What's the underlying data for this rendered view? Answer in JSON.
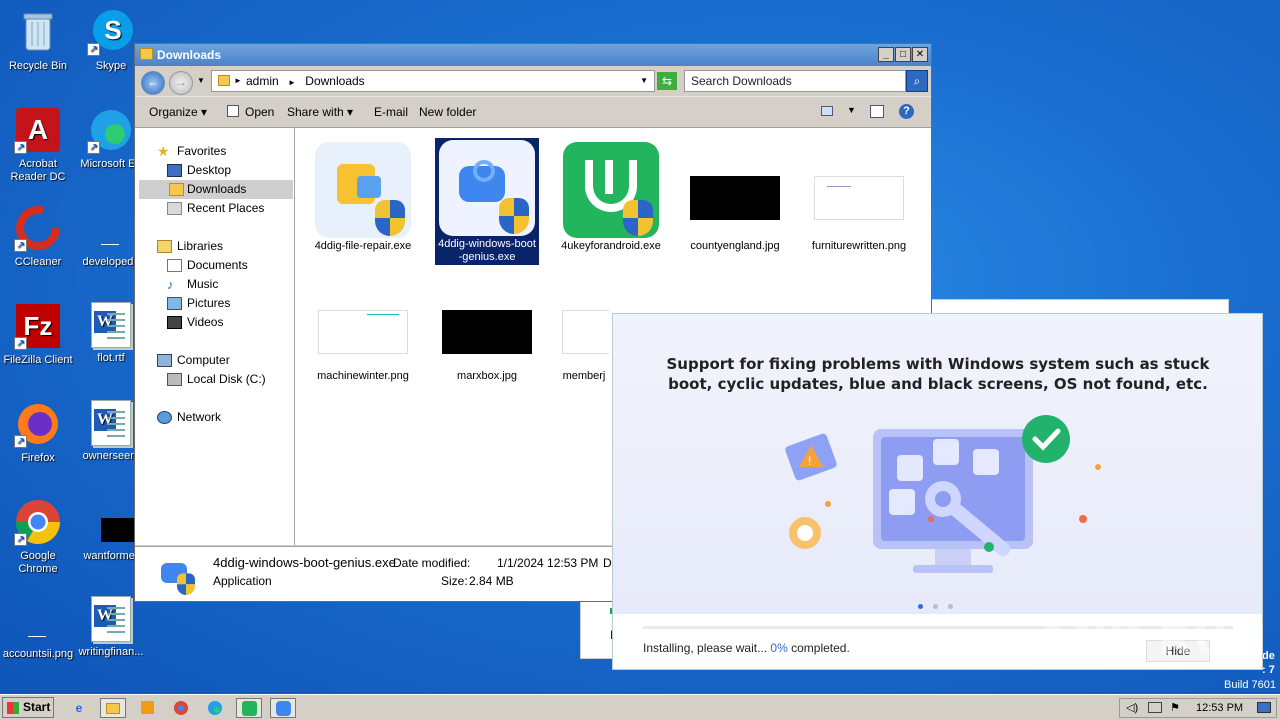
{
  "desktop": {
    "icons": [
      {
        "label": "Recycle Bin"
      },
      {
        "label": "Skype"
      },
      {
        "label": "Acrobat Reader DC"
      },
      {
        "label": "Microsoft Ed"
      },
      {
        "label": "CCleaner"
      },
      {
        "label": "developedb"
      },
      {
        "label": "FileZilla Client"
      },
      {
        "label": "flot.rtf"
      },
      {
        "label": "Firefox"
      },
      {
        "label": "ownerseen."
      },
      {
        "label": "Google Chrome"
      },
      {
        "label": "wantformer"
      },
      {
        "label": "accountsii.png"
      },
      {
        "label": "writingfinan..."
      }
    ],
    "watermark": "ANY RUN",
    "build_text": "Build 7601",
    "corner_text_1": "de",
    "corner_text_2": ": 7"
  },
  "explorer": {
    "title": "Downloads",
    "breadcrumb": [
      "admin",
      "Downloads"
    ],
    "search_placeholder": "Search Downloads",
    "toolbar": [
      "Organize",
      "Open",
      "Share with",
      "E-mail",
      "New folder"
    ],
    "nav": {
      "favorites": "Favorites",
      "favorites_items": [
        "Desktop",
        "Downloads",
        "Recent Places"
      ],
      "libraries": "Libraries",
      "libraries_items": [
        "Documents",
        "Music",
        "Pictures",
        "Videos"
      ],
      "computer": "Computer",
      "computer_items": [
        "Local Disk (C:)"
      ],
      "network": "Network"
    },
    "files": [
      {
        "name": "4ddig-file-repair.exe"
      },
      {
        "name": "4ddig-windows-boot-genius.exe"
      },
      {
        "name": "4ukeyforandroid.exe"
      },
      {
        "name": "countyengland.jpg"
      },
      {
        "name": "furniturewritten.png"
      },
      {
        "name": "machinewinter.png"
      },
      {
        "name": "marxbox.jpg"
      },
      {
        "name": "memberj"
      }
    ],
    "details": {
      "name": "4ddig-windows-boot-genius.exe",
      "date_label": "Date modified:",
      "date_value": "1/1/2024 12:53 PM",
      "type": "Application",
      "size_label": "Size:",
      "size_value": "2.84 MB",
      "extra": "Da"
    }
  },
  "installer": {
    "headline": "Support for fixing problems with Windows system such as stuck boot, cyclic updates, blue and black screens, OS not found, etc.",
    "status_prefix": "Installing, please wait...",
    "percent_text": "0%",
    "status_suffix": "completed.",
    "progress": 0,
    "hide_label": "Hide",
    "accent": "#2d6cdf"
  },
  "behind_window": {
    "text": "I"
  },
  "taskbar": {
    "start_label": "Start",
    "time": "12:53 PM"
  }
}
